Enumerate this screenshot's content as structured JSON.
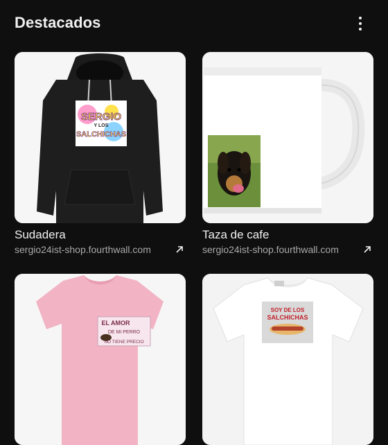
{
  "header": {
    "title": "Destacados"
  },
  "products": [
    {
      "name": "Sudadera",
      "url": "sergio24ist-shop.fourthwall.com",
      "icon": "hoodie-image",
      "print_text": [
        "SERGIO",
        "Y LOS",
        "SALCHICHAS"
      ]
    },
    {
      "name": "Taza de cafe",
      "url": "sergio24ist-shop.fourthwall.com",
      "icon": "mug-image"
    },
    {
      "name": "",
      "url": "",
      "icon": "pink-tshirt-image",
      "print_text": [
        "EL AMOR",
        "DE MI PERRO",
        "NO TIENE PRECIO"
      ]
    },
    {
      "name": "",
      "url": "",
      "icon": "white-tshirt-image",
      "print_text": [
        "SOY DE LOS",
        "SALCHICHAS"
      ]
    }
  ],
  "colors": {
    "background": "#0f0f0f",
    "text": "#f1f1f1",
    "secondary": "#aaaaaa"
  }
}
